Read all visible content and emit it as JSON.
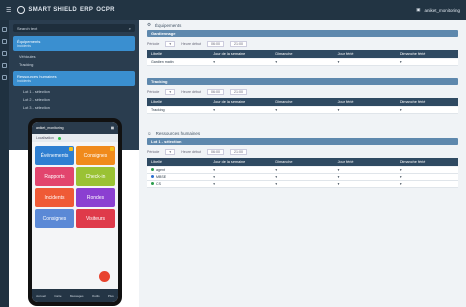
{
  "header": {
    "app": "SMART SHIELD",
    "product": "ERP",
    "partner": "OCPR",
    "user": "aniket_monitoring"
  },
  "sidebar": {
    "search_placeholder": "Search text",
    "group1": {
      "title": "Équipements",
      "sub": "Incidents"
    },
    "group1_items": [
      "Véhicules",
      "Tracking"
    ],
    "group2": {
      "title": "Ressources humaines",
      "sub": "Incidents"
    },
    "group2_items": [
      "Lot 1 - sélection",
      "Lot 2 - sélection",
      "Lot 3 - sélection"
    ]
  },
  "sections": [
    {
      "title": "Équipements",
      "bar": "Gardiennage",
      "row": "Gardien matin",
      "filter1": "Période",
      "filter2": "Heure début",
      "time1": "06:00",
      "time2": "21:00"
    },
    {
      "title": "",
      "bar": "Tracking",
      "row": "Tracking",
      "filter1": "Période",
      "filter2": "Heure début",
      "time1": "06:00",
      "time2": "21:00"
    },
    {
      "title": "Ressources humaines",
      "bar": "Lot 1 - sélection",
      "row": "",
      "filter1": "Période",
      "filter2": "Heure début",
      "time1": "06:00",
      "time2": "21:00"
    }
  ],
  "table_headers": [
    "Libellé",
    "Jour de la semaine",
    "Dimanche",
    "Jour férié",
    "Dimanche férié"
  ],
  "hr_rows": [
    "agent",
    "MBSE",
    "CS"
  ],
  "phone": {
    "user": "aniket_monitoring",
    "status": "Localisation",
    "tiles": [
      {
        "label": "Événements",
        "color": "#2f7fd1"
      },
      {
        "label": "Consignes",
        "color": "#f08a1c"
      },
      {
        "label": "Rapports",
        "color": "#e2456d"
      },
      {
        "label": "Check-in",
        "color": "#9ac234"
      },
      {
        "label": "Incidents",
        "color": "#ef5a36"
      },
      {
        "label": "Rondes",
        "color": "#8b3fd1"
      },
      {
        "label": "Consignes",
        "color": "#5b89d6"
      },
      {
        "label": "Visiteurs",
        "color": "#df3a4a"
      }
    ],
    "nav": [
      "Accueil",
      "Carte",
      "Messages",
      "Outils",
      "Plus"
    ]
  }
}
